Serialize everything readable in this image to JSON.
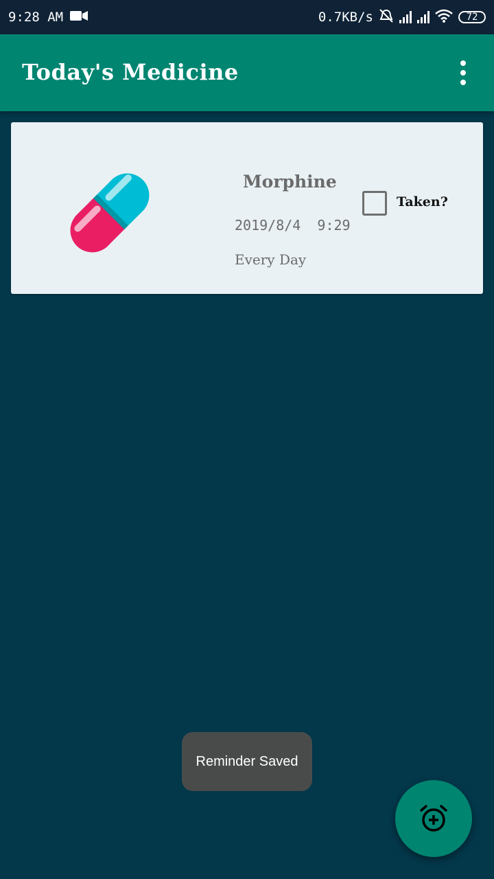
{
  "status_bar": {
    "time": "9:28 AM",
    "network_speed": "0.7KB/s",
    "battery": "72",
    "icons": [
      "video-camera-icon",
      "alarm-off-icon",
      "signal-icon",
      "signal-icon",
      "wifi-icon",
      "battery-icon"
    ]
  },
  "app_bar": {
    "title": "Today's Medicine",
    "menu_icon": "more-vert-icon"
  },
  "reminders": [
    {
      "icon": "pill-icon",
      "name": "Morphine",
      "datetime": "2019/8/4  9:29",
      "frequency": "Every Day",
      "taken_label": "Taken?",
      "taken": false
    }
  ],
  "toast": {
    "message": "Reminder Saved"
  },
  "fab": {
    "icon": "add-alarm-icon"
  },
  "colors": {
    "background": "#03374a",
    "app_bar": "#008571",
    "status_bar": "#0f2236",
    "card": "#e9f1f4",
    "pill_cyan": "#00bcd4",
    "pill_pink": "#e91e63"
  }
}
